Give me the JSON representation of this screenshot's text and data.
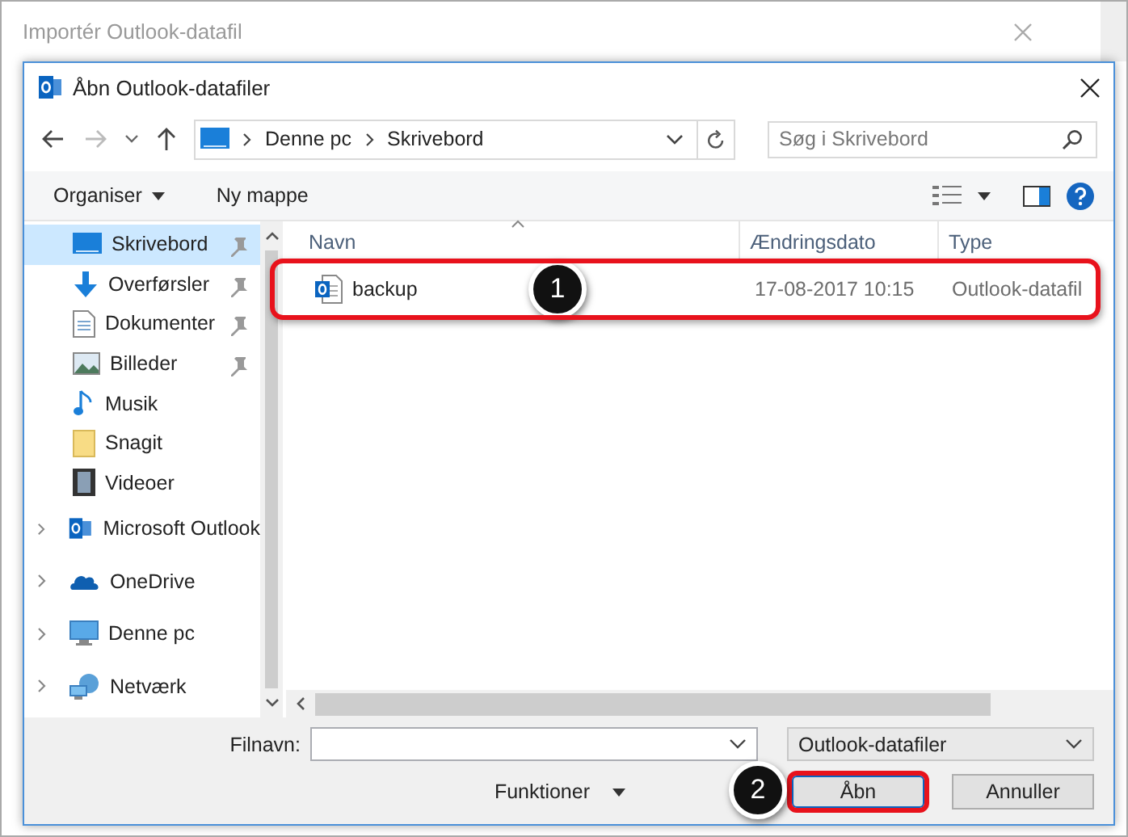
{
  "window": {
    "title": "Importér Outlook-datafil"
  },
  "dialog": {
    "title": "Åbn Outlook-datafiler"
  },
  "nav": {
    "back_disabled": false,
    "forward_disabled": true
  },
  "address": {
    "path": [
      "Denne pc",
      "Skrivebord"
    ]
  },
  "search": {
    "placeholder": "Søg i Skrivebord"
  },
  "toolbar": {
    "organize": "Organiser",
    "new_folder": "Ny mappe"
  },
  "sidebar": {
    "items": [
      {
        "label": "Skrivebord",
        "kind": "desktop",
        "pinned": true,
        "selected": true,
        "group": false
      },
      {
        "label": "Overførsler",
        "kind": "download",
        "pinned": true,
        "selected": false,
        "group": false
      },
      {
        "label": "Dokumenter",
        "kind": "document",
        "pinned": true,
        "selected": false,
        "group": false
      },
      {
        "label": "Billeder",
        "kind": "pictures",
        "pinned": true,
        "selected": false,
        "group": false
      },
      {
        "label": "Musik",
        "kind": "music",
        "pinned": false,
        "selected": false,
        "group": false
      },
      {
        "label": "Snagit",
        "kind": "folder",
        "pinned": false,
        "selected": false,
        "group": false
      },
      {
        "label": "Videoer",
        "kind": "video",
        "pinned": false,
        "selected": false,
        "group": false
      },
      {
        "label": "Microsoft Outlook",
        "kind": "outlook",
        "pinned": false,
        "selected": false,
        "group": true
      },
      {
        "label": "OneDrive",
        "kind": "cloud",
        "pinned": false,
        "selected": false,
        "group": true
      },
      {
        "label": "Denne pc",
        "kind": "pc",
        "pinned": false,
        "selected": false,
        "group": true
      },
      {
        "label": "Netværk",
        "kind": "network",
        "pinned": false,
        "selected": false,
        "group": true
      }
    ]
  },
  "table": {
    "columns": [
      "Navn",
      "Ændringsdato",
      "Type"
    ],
    "rows": [
      {
        "name": "backup",
        "date": "17-08-2017 10:15",
        "type": "Outlook-datafil"
      }
    ]
  },
  "callouts": [
    "1",
    "2"
  ],
  "bottom": {
    "filename_label": "Filnavn:",
    "filter": "Outlook-datafiler",
    "tools": "Funktioner",
    "buttons": [
      {
        "label": "Åbn",
        "kind": "primary"
      },
      {
        "label": "Annuller",
        "kind": "cancel"
      }
    ]
  }
}
